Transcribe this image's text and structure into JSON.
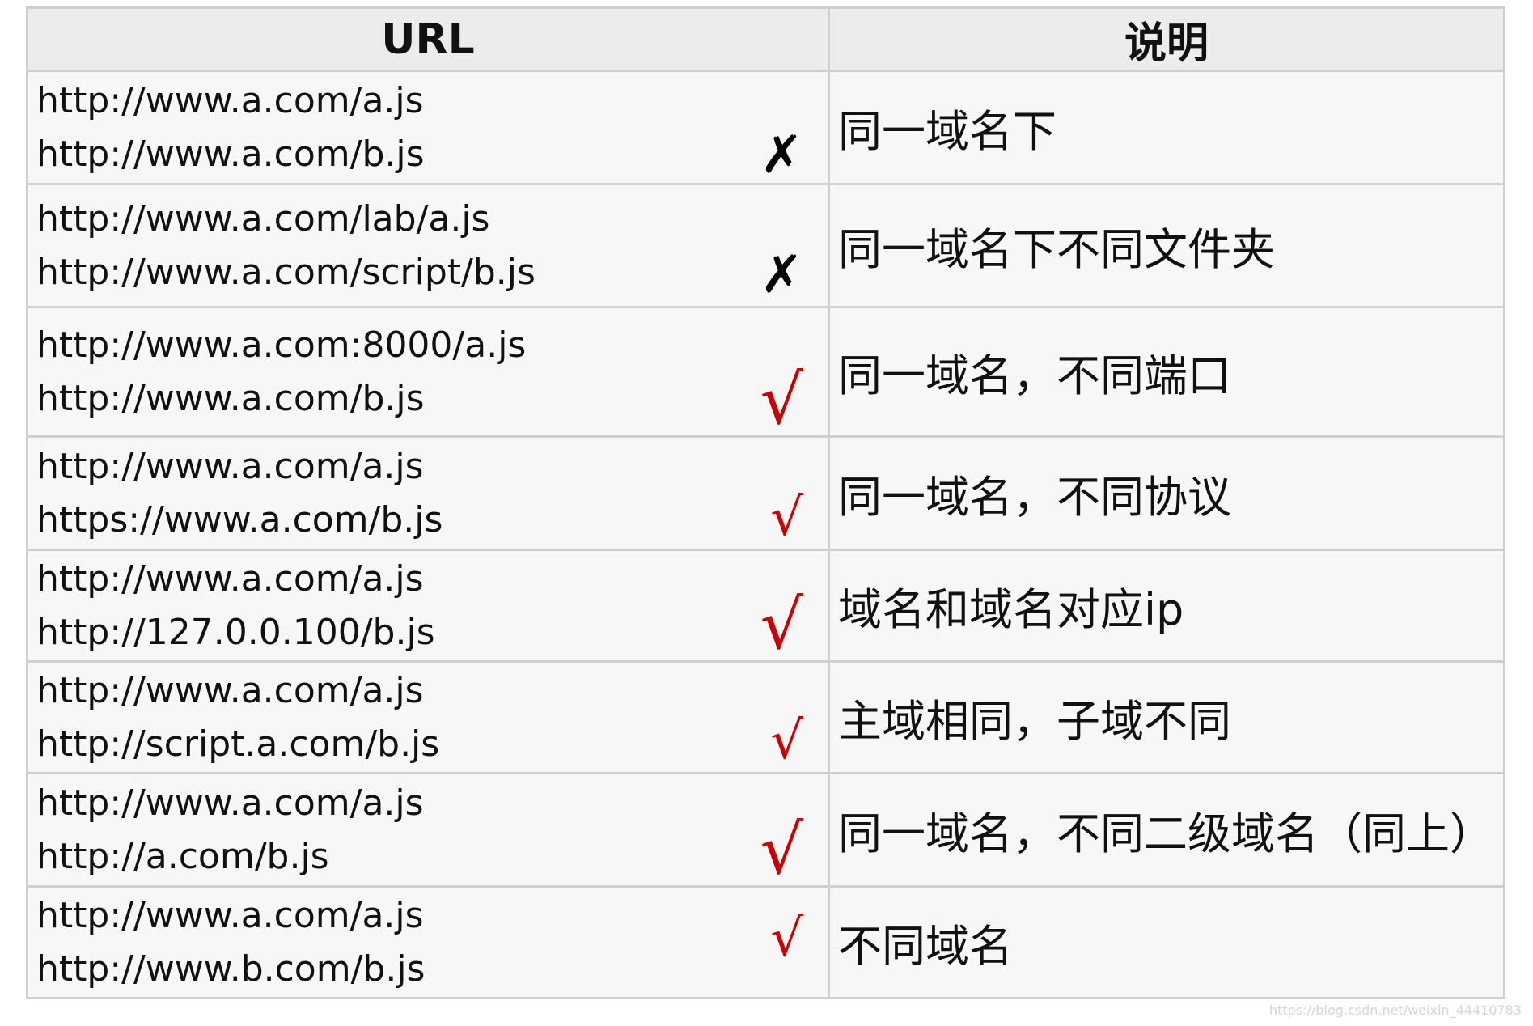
{
  "header": {
    "url": "URL",
    "desc": "说明"
  },
  "rows": [
    {
      "url1": "http://www.a.com/a.js",
      "url2": "http://www.a.com/b.js",
      "mark": "✗",
      "mark_color": "#000000",
      "desc": "同一域名下"
    },
    {
      "url1": "http://www.a.com/lab/a.js",
      "url2": "http://www.a.com/script/b.js",
      "mark": "✗",
      "mark_color": "#000000",
      "desc": "同一域名下不同文件夹"
    },
    {
      "url1": "http://www.a.com:8000/a.js",
      "url2": "http://www.a.com/b.js",
      "mark": "√",
      "mark_color": "#cc0000",
      "desc": "同一域名，不同端口"
    },
    {
      "url1": "http://www.a.com/a.js",
      "url2": "https://www.a.com/b.js",
      "mark": "√",
      "mark_color": "#cc0000",
      "desc": "同一域名，不同协议"
    },
    {
      "url1": "http://www.a.com/a.js",
      "url2": "http://127.0.0.100/b.js",
      "mark": "√",
      "mark_color": "#cc0000",
      "desc": "域名和域名对应ip"
    },
    {
      "url1": "http://www.a.com/a.js",
      "url2": "http://script.a.com/b.js",
      "mark": "√",
      "mark_color": "#cc0000",
      "desc": "主域相同，子域不同"
    },
    {
      "url1": "http://www.a.com/a.js",
      "url2": "http://a.com/b.js",
      "mark": "√",
      "mark_color": "#cc0000",
      "desc": "同一域名，不同二级域名（同上）"
    },
    {
      "url1": "http://www.a.com/a.js",
      "url2": "http://www.b.com/b.js",
      "mark": "√",
      "mark_color": "#cc0000",
      "desc": "不同域名"
    }
  ],
  "watermark": "https://blog.csdn.net/weixin_44410783"
}
